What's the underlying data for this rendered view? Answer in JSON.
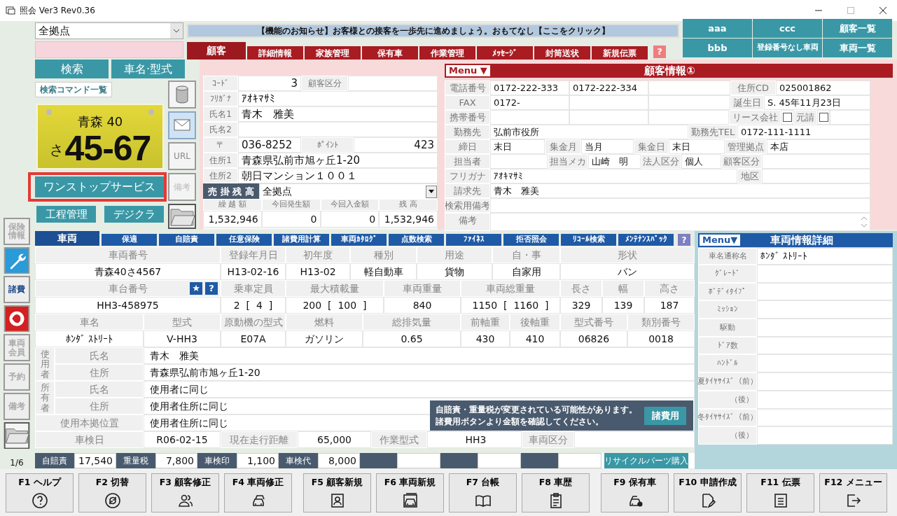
{
  "window": {
    "title": "照会 Ver3 Rev0.36"
  },
  "search": {
    "location": "全拠点",
    "buttons": [
      "検索",
      "車名·型式"
    ],
    "command_list": "検索コマンド一覧"
  },
  "plate": {
    "region": "青森 40",
    "kana": "さ",
    "number": "45-67"
  },
  "service_buttons": [
    {
      "label": "ワンストップサービス",
      "highlighted": true
    },
    {
      "label": "工程管理",
      "highlighted": false
    },
    {
      "label": "デジクラ",
      "highlighted": false
    }
  ],
  "side_buttons": [
    {
      "label": "保険情報",
      "disabled": true
    },
    {
      "label": "諸費",
      "disabled": false
    },
    {
      "label": "車両会員",
      "disabled": true
    },
    {
      "label": "予約",
      "disabled": true
    },
    {
      "label": "備考",
      "disabled": true
    }
  ],
  "page_indicator": "1/6",
  "tool_buttons": [
    {
      "label": "URL",
      "disabled": false
    },
    {
      "label": "備考",
      "disabled": true
    }
  ],
  "notice": "【機能のお知らせ】お客様との接客を一歩先に進めましょう。おもてなし【ここをクリック】",
  "customer_tabs": [
    {
      "label": "顧客",
      "selected": true
    },
    {
      "label": "詳細情報",
      "selected": false
    },
    {
      "label": "家族管理",
      "selected": false
    },
    {
      "label": "保有車",
      "selected": false
    },
    {
      "label": "作業管理",
      "selected": false
    },
    {
      "label": "ﾒｯｾｰｼﾞ",
      "selected": false
    },
    {
      "label": "封筒送状",
      "selected": false
    },
    {
      "label": "新規伝票",
      "selected": false
    }
  ],
  "customer_help": "?",
  "quick_buttons": [
    "aaa",
    "ccc",
    "顧客一覧",
    "bbb",
    "登録番号なし車両",
    "車両一覧"
  ],
  "customer": {
    "rows": [
      [
        {
          "kind": "label",
          "text": "ｺｰﾄﾞ"
        },
        {
          "kind": "number",
          "text": "3"
        },
        {
          "kind": "label",
          "text": "顧客区分"
        },
        {
          "kind": "blank"
        }
      ],
      [
        {
          "kind": "label",
          "text": "ﾌﾘｶﾞﾅ"
        },
        {
          "kind": "value",
          "text": "ｱｵｷﾏｻﾐ"
        }
      ],
      [
        {
          "kind": "label",
          "text": "氏名1"
        },
        {
          "kind": "value",
          "text": "青木　雅美"
        }
      ],
      [
        {
          "kind": "label",
          "text": "氏名2"
        },
        {
          "kind": "blank"
        }
      ],
      [
        {
          "kind": "label",
          "text": "〒"
        },
        {
          "kind": "value",
          "text": "036-8252"
        },
        {
          "kind": "label",
          "text": "ﾎﾟｲﾝﾄ"
        },
        {
          "kind": "number",
          "text": "423"
        }
      ],
      [
        {
          "kind": "label",
          "text": "住所1"
        },
        {
          "kind": "value",
          "text": "青森県弘前市旭ヶ丘1-20"
        }
      ],
      [
        {
          "kind": "label",
          "text": "住所2"
        },
        {
          "kind": "value",
          "text": "朝日マンション１００１"
        }
      ]
    ],
    "balance": {
      "label": "売 掛 残 高",
      "location": "全拠点",
      "columns": [
        "繰 越 額",
        "今回発生額",
        "今回入金額",
        "残 高"
      ],
      "values": [
        "1,532,946",
        "0",
        "0",
        "1,532,946"
      ]
    }
  },
  "customer_info": {
    "menu": "Menu ▼",
    "title": "顧客情報①",
    "lines": [
      {
        "fields": [
          {
            "kind": "label",
            "text": "電話番号"
          },
          {
            "kind": "value",
            "text": "0172-222-333"
          },
          {
            "kind": "value",
            "text": "0172-222-334"
          },
          {
            "kind": "blank"
          },
          {
            "kind": "label",
            "text": "住所CD"
          },
          {
            "kind": "value",
            "text": "025001862"
          }
        ]
      },
      {
        "fields": [
          {
            "kind": "label",
            "text": "FAX"
          },
          {
            "kind": "value",
            "text": "0172-"
          },
          {
            "kind": "blank"
          },
          {
            "kind": "blank"
          },
          {
            "kind": "label",
            "text": "誕生日"
          },
          {
            "kind": "value",
            "text": "S. 45年11月23日"
          }
        ]
      },
      {
        "fields": [
          {
            "kind": "label",
            "text": "携帯番号"
          },
          {
            "kind": "blank"
          },
          {
            "kind": "blank"
          },
          {
            "kind": "blank"
          },
          {
            "kind": "label",
            "text": "リース会社"
          },
          {
            "kind": "checkbox",
            "checked": false
          },
          {
            "kind": "label",
            "text": "元請"
          },
          {
            "kind": "checkbox",
            "checked": false
          },
          {
            "kind": "blank"
          }
        ]
      },
      {
        "fields": [
          {
            "kind": "label",
            "text": "勤務先"
          },
          {
            "kind": "value",
            "text": "弘前市役所"
          },
          {
            "kind": "label",
            "text": "勤務先TEL"
          },
          {
            "kind": "value",
            "text": "0172-111-1111"
          }
        ]
      },
      {
        "fields": [
          {
            "kind": "label",
            "text": "締日"
          },
          {
            "kind": "value",
            "text": "末日"
          },
          {
            "kind": "label",
            "text": "集金月"
          },
          {
            "kind": "value",
            "text": "当月"
          },
          {
            "kind": "label",
            "text": "集金日"
          },
          {
            "kind": "value",
            "text": "末日"
          },
          {
            "kind": "label",
            "text": "管理拠点"
          },
          {
            "kind": "value",
            "text": "本店"
          }
        ]
      },
      {
        "fields": [
          {
            "kind": "label",
            "text": "担当者"
          },
          {
            "kind": "blank"
          },
          {
            "kind": "label",
            "text": "担当メカ"
          },
          {
            "kind": "value",
            "text": "山崎　明"
          },
          {
            "kind": "label",
            "text": "法人区分"
          },
          {
            "kind": "value",
            "text": "個人"
          },
          {
            "kind": "label",
            "text": "顧客区分"
          },
          {
            "kind": "blank"
          }
        ]
      },
      {
        "fields": [
          {
            "kind": "label",
            "text": "フリガナ"
          },
          {
            "kind": "value",
            "text": "ｱｵｷﾏｻﾐ"
          },
          {
            "kind": "label",
            "text": "地区"
          },
          {
            "kind": "blank"
          }
        ]
      },
      {
        "fields": [
          {
            "kind": "label",
            "text": "請求先"
          },
          {
            "kind": "value",
            "text": "青木　雅美"
          }
        ]
      },
      {
        "fields": [
          {
            "kind": "label",
            "text": "検索用備考"
          },
          {
            "kind": "blank"
          }
        ]
      },
      {
        "fields": [
          {
            "kind": "label",
            "text": "備考"
          },
          {
            "kind": "memo"
          }
        ]
      }
    ]
  },
  "vehicle_tabs": [
    {
      "label": "車両",
      "selected": true
    },
    {
      "label": "保適",
      "selected": false
    },
    {
      "label": "自賠責",
      "selected": false
    },
    {
      "label": "任意保険",
      "selected": false
    },
    {
      "label": "諸費用計算",
      "selected": false
    },
    {
      "label": "車両ｶﾀﾛｸﾞ",
      "selected": false
    },
    {
      "label": "点数検索",
      "selected": false
    },
    {
      "label": "ﾌｧｲﾈｽ",
      "selected": false
    },
    {
      "label": "拒否照会",
      "selected": false
    },
    {
      "label": "ﾘｺｰﾙ検索",
      "selected": false
    },
    {
      "label": "ﾒﾝﾃﾅﾝｽﾊﾟｯｸ",
      "selected": false
    }
  ],
  "vehicle_help": "?",
  "vehicle": {
    "spec_rows": [
      [
        {
          "kind": "label",
          "text": "車両番号"
        },
        {
          "kind": "label",
          "text": "登録年月日"
        },
        {
          "kind": "label",
          "text": "初年度"
        },
        {
          "kind": "label",
          "text": "種別"
        },
        {
          "kind": "label",
          "text": "用途"
        },
        {
          "kind": "label",
          "text": "自・事"
        },
        {
          "kind": "label",
          "text": "形状"
        }
      ],
      [
        {
          "kind": "value",
          "text": "青森40さ4567"
        },
        {
          "kind": "value",
          "text": "H13-02-16"
        },
        {
          "kind": "value",
          "text": "H13-02"
        },
        {
          "kind": "value",
          "text": "軽自動車"
        },
        {
          "kind": "value",
          "text": "貨物"
        },
        {
          "kind": "value",
          "text": "自家用"
        },
        {
          "kind": "value",
          "text": "バン"
        }
      ],
      [
        {
          "kind": "label",
          "text": "車台番号",
          "buttons": [
            "★",
            "?"
          ]
        },
        {
          "kind": "label",
          "text": "乗車定員"
        },
        {
          "kind": "label",
          "text": "最大積載量"
        },
        {
          "kind": "label",
          "text": "車両重量"
        },
        {
          "kind": "label",
          "text": "車両総重量"
        },
        {
          "kind": "label",
          "text": "長さ"
        },
        {
          "kind": "label",
          "text": "幅"
        },
        {
          "kind": "label",
          "text": "高さ"
        }
      ],
      [
        {
          "kind": "value",
          "text": "HH3-458975"
        },
        {
          "kind": "value",
          "text": "2  [  4  ]"
        },
        {
          "kind": "value",
          "text": "200  [  100  ]"
        },
        {
          "kind": "value",
          "text": "840"
        },
        {
          "kind": "value",
          "text": "1150  [  1160  ]"
        },
        {
          "kind": "value",
          "text": "329"
        },
        {
          "kind": "value",
          "text": "139"
        },
        {
          "kind": "value",
          "text": "187"
        }
      ],
      [
        {
          "kind": "label",
          "text": "車名"
        },
        {
          "kind": "label",
          "text": "型式"
        },
        {
          "kind": "label",
          "text": "原動機の型式"
        },
        {
          "kind": "label",
          "text": "燃料"
        },
        {
          "kind": "label",
          "text": "総排気量"
        },
        {
          "kind": "label",
          "text": "前軸重"
        },
        {
          "kind": "label",
          "text": "後軸重"
        },
        {
          "kind": "label",
          "text": "型式番号"
        },
        {
          "kind": "label",
          "text": "類別番号"
        }
      ],
      [
        {
          "kind": "value",
          "text": "ﾎﾝﾀﾞ ｽﾄﾘｰﾄ"
        },
        {
          "kind": "value",
          "text": "V-HH3"
        },
        {
          "kind": "value",
          "text": "E07A"
        },
        {
          "kind": "value",
          "text": "ガソリン"
        },
        {
          "kind": "value",
          "text": "0.65"
        },
        {
          "kind": "value",
          "text": "430"
        },
        {
          "kind": "value",
          "text": "410"
        },
        {
          "kind": "value",
          "text": "06826"
        },
        {
          "kind": "value",
          "text": "0018"
        }
      ]
    ],
    "parties": [
      {
        "group": "使用者",
        "rows": [
          {
            "label": "氏名",
            "value": "青木　雅美"
          },
          {
            "label": "住所",
            "value": "青森県弘前市旭ヶ丘1-20"
          }
        ]
      },
      {
        "group": "所有者",
        "rows": [
          {
            "label": "氏名",
            "value": "使用者に同じ"
          },
          {
            "label": "住所",
            "value": "使用者住所に同じ"
          }
        ]
      }
    ],
    "base": {
      "label": "使用本拠位置",
      "value": "使用者住所に同じ"
    },
    "inspection_row": [
      {
        "kind": "label",
        "text": "車検日"
      },
      {
        "kind": "value",
        "text": "R06-02-15"
      },
      {
        "kind": "label",
        "text": "現在走行距離"
      },
      {
        "kind": "value",
        "text": "65,000"
      },
      {
        "kind": "label",
        "text": "作業型式"
      },
      {
        "kind": "value",
        "text": "HH3"
      },
      {
        "kind": "label",
        "text": "車両区分"
      },
      {
        "kind": "blank"
      }
    ]
  },
  "fee_notice": {
    "lines": [
      "自賠責・重量税が変更されている可能性があります。",
      "諸費用ボタンより金額を確認してください。"
    ],
    "button": "諸費用"
  },
  "fees": [
    {
      "label": "自賠責",
      "value": "17,540"
    },
    {
      "label": "重量税",
      "value": "7,800"
    },
    {
      "label": "車検印",
      "value": "1,100"
    },
    {
      "label": "車検代",
      "value": "8,000"
    }
  ],
  "recycle_button": "リサイクルパーツ購入",
  "vehicle_detail": {
    "menu": "Menu▼",
    "title": "車両情報詳細",
    "rows": [
      {
        "label": "車名通称名",
        "value": "ﾎﾝﾀﾞ ｽﾄﾘｰﾄ"
      },
      {
        "label": "ｸﾞﾚｰﾄﾞ"
      },
      {
        "label": "ﾎﾞﾃﾞｨﾀｲﾌﾟ"
      },
      {
        "label": "ﾐｯｼｮﾝ"
      },
      {
        "label": "駆動"
      },
      {
        "label": "ﾄﾞｱ数"
      },
      {
        "label": "ﾊﾝﾄﾞﾙ"
      },
      {
        "label": "夏ﾀｲﾔｻｲｽﾞ（前）"
      },
      {
        "label": "（後）"
      },
      {
        "label": "冬ﾀｲﾔｻｲｽﾞ（前）"
      },
      {
        "label": "（後）"
      }
    ]
  },
  "function_keys": [
    "F1 ヘルプ",
    "F2 切替",
    "F3 顧客修正",
    "F4 車両修正",
    "F5 顧客新規",
    "F6 車両新規",
    "F7 台帳",
    "F8 車歴",
    "F9 保有車",
    "F10 申請作成",
    "F11 伝票",
    "F12 メニュー"
  ]
}
